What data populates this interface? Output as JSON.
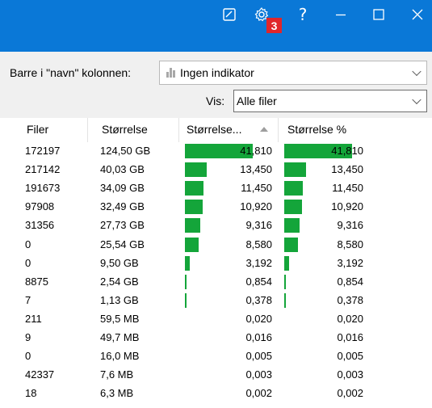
{
  "titlebar": {
    "background": "#0a78d7",
    "icons": [
      "note-icon",
      "gear-icon",
      "help-icon",
      "minimize-icon",
      "maximize-icon",
      "close-icon"
    ],
    "badge": "3",
    "help_glyph": "?"
  },
  "toolbar": {
    "bars_label": "Barre i \"navn\" kolonnen:",
    "bars_value": "Ingen indikator",
    "vis_label": "Vis:",
    "vis_value": "Alle filer"
  },
  "table": {
    "headers": [
      "Filer",
      "Størrelse",
      "Størrelse...",
      "Størrelse %"
    ],
    "sort_column": 2,
    "sort_direction": "ascending",
    "bar_color": "#14a53a",
    "rows": [
      {
        "files": "172197",
        "size": "124,50 GB",
        "pct": "41,810",
        "pct2": "41,810",
        "fraction": 0.418
      },
      {
        "files": "217142",
        "size": "40,03 GB",
        "pct": "13,450",
        "pct2": "13,450",
        "fraction": 0.1345
      },
      {
        "files": "191673",
        "size": "34,09 GB",
        "pct": "11,450",
        "pct2": "11,450",
        "fraction": 0.1145
      },
      {
        "files": "97908",
        "size": "32,49 GB",
        "pct": "10,920",
        "pct2": "10,920",
        "fraction": 0.1092
      },
      {
        "files": "31356",
        "size": "27,73 GB",
        "pct": "9,316",
        "pct2": "9,316",
        "fraction": 0.0932
      },
      {
        "files": "0",
        "size": "25,54 GB",
        "pct": "8,580",
        "pct2": "8,580",
        "fraction": 0.0858
      },
      {
        "files": "0",
        "size": "9,50 GB",
        "pct": "3,192",
        "pct2": "3,192",
        "fraction": 0.0319
      },
      {
        "files": "8875",
        "size": "2,54 GB",
        "pct": "0,854",
        "pct2": "0,854",
        "fraction": 0.0085
      },
      {
        "files": "7",
        "size": "1,13 GB",
        "pct": "0,378",
        "pct2": "0,378",
        "fraction": 0.0038
      },
      {
        "files": "211",
        "size": "59,5 MB",
        "pct": "0,020",
        "pct2": "0,020",
        "fraction": 0.0002
      },
      {
        "files": "9",
        "size": "49,7 MB",
        "pct": "0,016",
        "pct2": "0,016",
        "fraction": 0.0002
      },
      {
        "files": "0",
        "size": "16,0 MB",
        "pct": "0,005",
        "pct2": "0,005",
        "fraction": 5e-05
      },
      {
        "files": "42337",
        "size": "7,6 MB",
        "pct": "0,003",
        "pct2": "0,003",
        "fraction": 3e-05
      },
      {
        "files": "18",
        "size": "6,3 MB",
        "pct": "0,002",
        "pct2": "0,002",
        "fraction": 2e-05
      }
    ]
  }
}
